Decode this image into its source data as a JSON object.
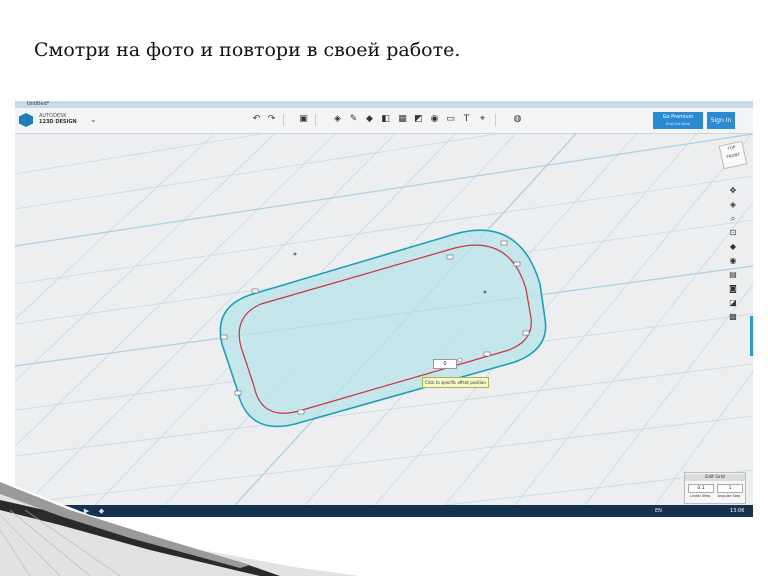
{
  "slide": {
    "instruction": "Смотри на фото и повтори в своей работе."
  },
  "app": {
    "window_title": "Untitled*",
    "brand_line1": "AUTODESK",
    "brand_line2": "123D DESIGN",
    "go_premium_label": "Go Premium",
    "go_premium_sub": "Find Out More",
    "sign_in_label": "Sign In",
    "toolbar_icons": [
      "undo-icon",
      "redo-icon",
      "material-icon",
      "primitives-icon",
      "sketch-icon",
      "construct-icon",
      "modify-icon",
      "pattern-icon",
      "grouping-icon",
      "combine-icon",
      "measure-icon",
      "text-icon",
      "snap-icon",
      "materials-icon"
    ],
    "viewcube_label": "TOP\nFRONT",
    "side_tools": [
      "pan-icon",
      "orbit-icon",
      "zoom-icon",
      "fit-icon",
      "view-icon",
      "visibility-icon",
      "material-view-icon",
      "screenshot-icon",
      "snap-tool-icon",
      "grid-tool-icon"
    ]
  },
  "canvas": {
    "offset_tooltip": "Click to specific offset position",
    "offset_value": "0",
    "accent_color": "#1fa0b8",
    "shape_fill": "#b8e4ea",
    "inner_outline_color": "#c8363c"
  },
  "edit_grid": {
    "title": "Edit Grid",
    "linear_step_value": "0.1",
    "angular_step_value": "1",
    "linear_step_label": "Linear Step",
    "angular_step_label": "Angular Step"
  },
  "taskbar": {
    "clock": "13:06",
    "tray_text": "EN"
  }
}
